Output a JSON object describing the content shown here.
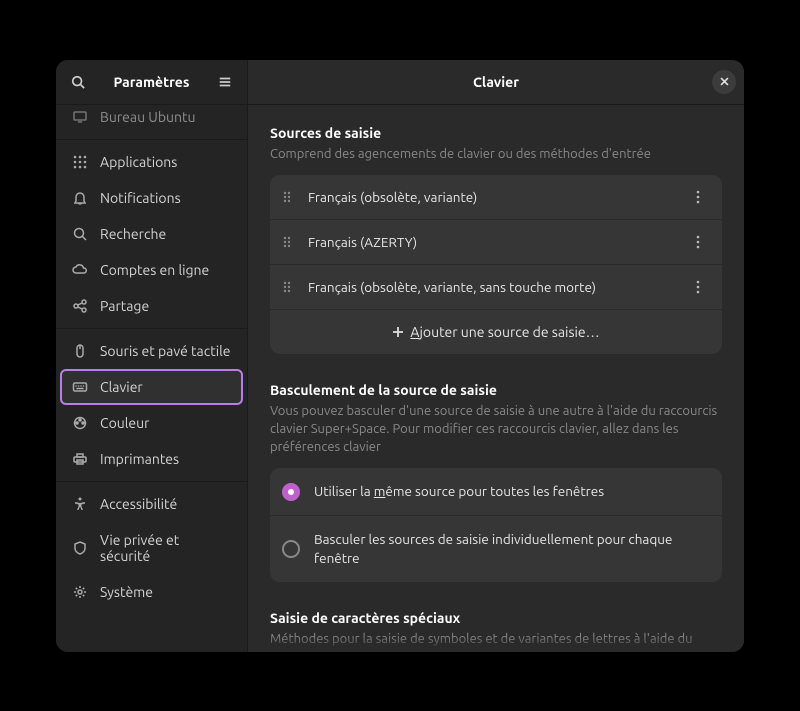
{
  "sidebar": {
    "title": "Paramètres",
    "partial_item": "Bureau Ubuntu",
    "groups": [
      [
        {
          "icon": "apps",
          "label": "Applications"
        },
        {
          "icon": "bell",
          "label": "Notifications"
        },
        {
          "icon": "search",
          "label": "Recherche"
        },
        {
          "icon": "cloud",
          "label": "Comptes en ligne"
        },
        {
          "icon": "share",
          "label": "Partage"
        }
      ],
      [
        {
          "icon": "mouse",
          "label": "Souris et pavé tactile"
        },
        {
          "icon": "keyboard",
          "label": "Clavier",
          "selected": true
        },
        {
          "icon": "color",
          "label": "Couleur"
        },
        {
          "icon": "printer",
          "label": "Imprimantes"
        }
      ],
      [
        {
          "icon": "accessibility",
          "label": "Accessibilité"
        },
        {
          "icon": "privacy",
          "label": "Vie privée et sécurité"
        },
        {
          "icon": "system",
          "label": "Système"
        }
      ]
    ]
  },
  "header": {
    "title": "Clavier"
  },
  "input_sources": {
    "title": "Sources de saisie",
    "desc": "Comprend des agencements de clavier ou des méthodes d'entrée",
    "items": [
      "Français (obsolète, variante)",
      "Français (AZERTY)",
      "Français (obsolète, variante, sans touche morte)"
    ],
    "add_prefix": "A",
    "add_suffix": "jouter une source de saisie…"
  },
  "switching": {
    "title": "Basculement de la source de saisie",
    "desc": "Vous pouvez basculer d'une source de saisie à une autre à l'aide du raccourcis clavier Super+Space. Pour modifier ces raccourcis clavier, allez dans les préférences clavier",
    "option1_prefix": "Utiliser la ",
    "option1_underline": "m",
    "option1_suffix": "ême source pour toutes les fenêtres",
    "option2": "Basculer les sources de saisie individuellement pour chaque fenêtre"
  },
  "special": {
    "title": "Saisie de caractères spéciaux",
    "desc": "Méthodes pour la saisie de symboles et de variantes de lettres à l'aide du clavier"
  }
}
